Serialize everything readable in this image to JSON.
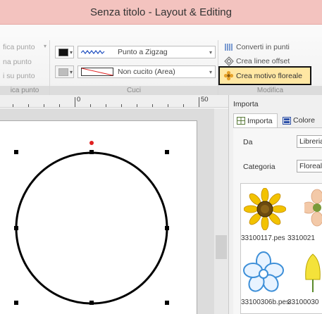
{
  "window": {
    "title": "Senza titolo - Layout & Editing"
  },
  "ribbon": {
    "left_group": {
      "items": [
        "fica punto",
        "na punto",
        "i su punto"
      ],
      "footer": "ica punto"
    },
    "cuci_group": {
      "footer": "Cuci",
      "stitch_type": "Punto a Zigzag",
      "area_type": "Non cucito (Area)"
    },
    "modifica_group": {
      "footer": "Modifica",
      "convert_label": "Converti in punti",
      "offset_label": "Crea linee offset",
      "floral_label": "Crea motivo floreale"
    }
  },
  "ruler": {
    "labels": [
      "0",
      "50"
    ]
  },
  "panel": {
    "title": "Importa",
    "tabs": [
      "Importa",
      "Colore"
    ],
    "from_label": "Da",
    "from_value": "Libreria",
    "category_label": "Categoria",
    "category_value": "Floreale",
    "thumbnails": [
      "33100117.pes",
      "3310021",
      "33100306b.pes",
      "33100030"
    ]
  },
  "colors": {
    "title_bar": "#f3c3bf",
    "highlight": "#ffe7a3",
    "sunflower": "#f2c200",
    "blue_flower": "#3d8fd8"
  }
}
